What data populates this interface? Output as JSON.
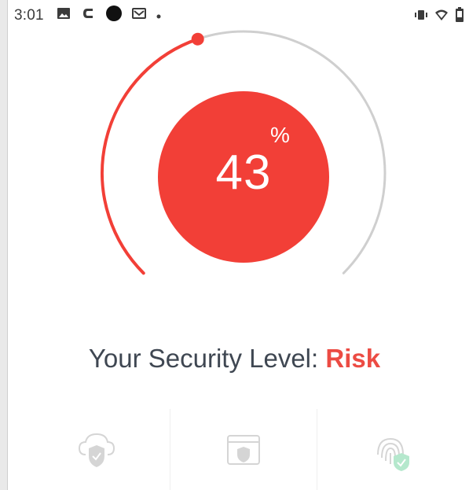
{
  "status_bar": {
    "time": "3:01",
    "left_icons": [
      "image-icon",
      "c-logo-icon",
      "record-dot-icon",
      "mail-icon",
      "notification-dot-icon"
    ],
    "right_icons": [
      "vibrate-icon",
      "wifi-icon",
      "battery-icon"
    ]
  },
  "gauge": {
    "progress_fraction": 0.43,
    "track_color": "#cfcfcf",
    "progress_color": "#f23f37"
  },
  "score": {
    "value": "43",
    "unit": "%",
    "color": "#f23f37"
  },
  "security": {
    "label": "Your Security Level:",
    "level": "Risk",
    "level_color": "#ec4b43"
  },
  "features": [
    {
      "icon": "cloud-shield-icon"
    },
    {
      "icon": "browser-shield-icon"
    },
    {
      "icon": "fingerprint-shield-icon"
    }
  ]
}
